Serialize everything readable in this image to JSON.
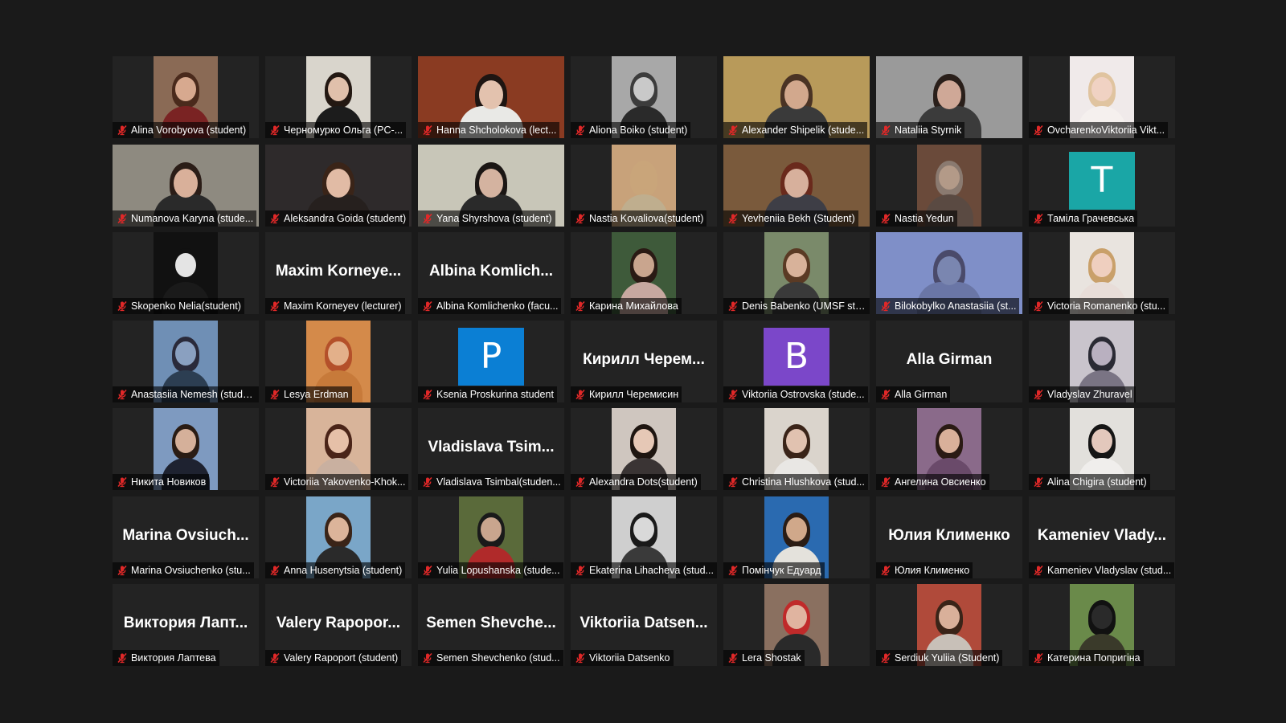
{
  "window": {
    "app": "video-conference",
    "view": "gallery"
  },
  "colors": {
    "background": "#1a1a1a",
    "tile": "#232323",
    "muted_icon": "#e02828",
    "label_text": "#ffffff"
  },
  "participants": [
    {
      "label": "Alina Vorobyova (student)",
      "mode": "video",
      "skin": "#d7a98f",
      "hair": "#4a2a1c",
      "body": "#7a2323",
      "bg": "#8a6a55"
    },
    {
      "label": "Черномурко Ольга (PC-...",
      "mode": "video",
      "skin": "#e0c0ab",
      "hair": "#231812",
      "body": "#1c1c1c",
      "bg": "#d9d5cc"
    },
    {
      "label": "Hanna Shcholokova (lect...",
      "mode": "video",
      "wide": true,
      "skin": "#e3c2ae",
      "hair": "#1e1512",
      "body": "#e9e9e6",
      "bg": "#8a3b22"
    },
    {
      "label": "Aliona Boiko (student)",
      "mode": "video",
      "skin": "#c9c9c9",
      "hair": "#3c3c3c",
      "body": "#2a2a2a",
      "bg": "#a8a8a8"
    },
    {
      "label": "Alexander Shipelik (stude...",
      "mode": "video",
      "wide": true,
      "skin": "#d2a88d",
      "hair": "#4a3324",
      "body": "#3a3a3a",
      "bg": "#b89a5a"
    },
    {
      "label": "Nataliia Styrnik",
      "mode": "video",
      "wide": true,
      "skin": "#cfa897",
      "hair": "#2a1f1a",
      "body": "#3b3b3b",
      "bg": "#9a9a9a"
    },
    {
      "label": "OvcharenkoViktoriia Vikt...",
      "mode": "video",
      "skin": "#f0d2c3",
      "hair": "#e0c4a0",
      "body": "#f5f0ee",
      "bg": "#f0eaea"
    },
    {
      "label": "Numanova Karyna (stude...",
      "mode": "video",
      "wide": true,
      "skin": "#d9b09a",
      "hair": "#2b1d17",
      "body": "#2a2a2a",
      "bg": "#8e8a80"
    },
    {
      "label": "Aleksandra Goida (student)",
      "mode": "video",
      "wide": true,
      "skin": "#e1bba5",
      "hair": "#3a2418",
      "body": "#26201e",
      "bg": "#2e2a2b"
    },
    {
      "label": "Yana Shyrshova (student)",
      "mode": "video",
      "wide": true,
      "skin": "#d4b3a0",
      "hair": "#1b1614",
      "body": "#2a2a2a",
      "bg": "#c8c6b8"
    },
    {
      "label": "Nastia Kovaliova(student)",
      "mode": "video",
      "skin": "#c9a57a",
      "hair": "#c9a57a",
      "body": "#bfae8e",
      "bg": "#c8a27a"
    },
    {
      "label": "Yevheniia Bekh (Student)",
      "mode": "video",
      "wide": true,
      "skin": "#d7b09c",
      "hair": "#6a2a1c",
      "body": "#3e3e46",
      "bg": "#7a5a3c"
    },
    {
      "label": "Nastia Yedun",
      "mode": "video",
      "skin": "#b39a88",
      "hair": "#8a7a70",
      "body": "#5a4a42",
      "bg": "#6a4a3a"
    },
    {
      "label": "Тамiла Грачевська",
      "mode": "letter",
      "letter": "T",
      "avatar_color": "#1aa6a6"
    },
    {
      "label": "Skopenko Nelia(student)",
      "mode": "video",
      "skin": "#e4e4e4",
      "hair": "#111111",
      "body": "#1a1a1a",
      "bg": "#111111"
    },
    {
      "label": "Maxim Korneyev (lecturer)",
      "mode": "name",
      "big": "Maxim  Korneye..."
    },
    {
      "label": "Albina Komlichenko (facu...",
      "mode": "name",
      "big": "Albina  Komlich..."
    },
    {
      "label": "Карина Михайлова",
      "mode": "video",
      "skin": "#c9a58e",
      "hair": "#2a1a14",
      "body": "#c7a8a0",
      "bg": "#3e5a3a"
    },
    {
      "label": "Denis Babenko (UMSF stu...",
      "mode": "video",
      "skin": "#d8b29a",
      "hair": "#5a3a24",
      "body": "#3a3a3a",
      "bg": "#7a8a6a"
    },
    {
      "label": "Bilokobylko Anastasiia (st...",
      "mode": "video",
      "wide": true,
      "skin": "#7a86b0",
      "hair": "#4a4a6a",
      "body": "#6a76a6",
      "bg": "#7f8fc8"
    },
    {
      "label": "Victoria Romanenko (stu...",
      "mode": "video",
      "skin": "#efcfbf",
      "hair": "#c9a06a",
      "body": "#e8ddd8",
      "bg": "#e9e4df"
    },
    {
      "label": "Anastasiia Nemesh (stude...",
      "mode": "video",
      "skin": "#8aa0c0",
      "hair": "#2a2a3a",
      "body": "#2c3e52",
      "bg": "#6f8fb5"
    },
    {
      "label": "Lesya Erdman",
      "mode": "video",
      "skin": "#e3b08a",
      "hair": "#b4502a",
      "body": "#c77a3a",
      "bg": "#d48a4a"
    },
    {
      "label": "Ksenia Proskurina student",
      "mode": "letter",
      "letter": "P",
      "avatar_color": "#0b7fd4"
    },
    {
      "label": "Кирилл Черемисин",
      "mode": "name",
      "big": "Кирилл  Черем..."
    },
    {
      "label": "Viktoriia Ostrovska (stude...",
      "mode": "letter",
      "letter": "B",
      "avatar_color": "#7b47c9"
    },
    {
      "label": "Alla Girman",
      "mode": "name",
      "big": "Alla Girman"
    },
    {
      "label": "Vladyslav Zhuravel",
      "mode": "video",
      "skin": "#b9b0c0",
      "hair": "#2a2a34",
      "body": "#7a7484",
      "bg": "#c9c4cc"
    },
    {
      "label": "Никита Новиков",
      "mode": "video",
      "skin": "#d5b09a",
      "hair": "#2a1c14",
      "body": "#1e2230",
      "bg": "#7e9ac0"
    },
    {
      "label": "Victoriia Yakovenko-Khok...",
      "mode": "video",
      "skin": "#e6c0a8",
      "hair": "#4a2418",
      "body": "#c9b0a0",
      "bg": "#d8b49a"
    },
    {
      "label": "Vladislava Tsimbal(studen...",
      "mode": "name",
      "big": "Vladislava  Tsim..."
    },
    {
      "label": "Alexandra Dots(student)",
      "mode": "video",
      "skin": "#e6c8b6",
      "hair": "#1e1510",
      "body": "#3a3434",
      "bg": "#cfc6bf"
    },
    {
      "label": "Christina Hlushkova (stud...",
      "mode": "video",
      "skin": "#e1c2b0",
      "hair": "#3a2418",
      "body": "#e9e7e4",
      "bg": "#dad4cc"
    },
    {
      "label": "Ангелина Овсиенко",
      "mode": "video",
      "skin": "#d9b09a",
      "hair": "#2a1a14",
      "body": "#6a4a6a",
      "bg": "#8a6a8a"
    },
    {
      "label": "Alina Chigira (student)",
      "mode": "video",
      "skin": "#e3c8bc",
      "hair": "#151515",
      "body": "#f0eeec",
      "bg": "#e2e0dc"
    },
    {
      "label": "Marina Ovsiuchenko (stu...",
      "mode": "name",
      "big": "Marina  Ovsiuch..."
    },
    {
      "label": "Anna Husenytsia (student)",
      "mode": "video",
      "skin": "#dcb49a",
      "hair": "#3a2418",
      "body": "#2a2a2a",
      "bg": "#7aa6c8"
    },
    {
      "label": "Yulia Lopushanska (stude...",
      "mode": "video",
      "skin": "#c9a58e",
      "hair": "#1a1a1a",
      "body": "#b02a2a",
      "bg": "#5a6a3a"
    },
    {
      "label": "Ekaterina Lihacheva (stud...",
      "mode": "video",
      "skin": "#d9d9d9",
      "hair": "#1a1a1a",
      "body": "#3a3a3a",
      "bg": "#cfcfcf"
    },
    {
      "label": "Помінчук Едуард",
      "mode": "video",
      "skin": "#d0a88a",
      "hair": "#2a1c14",
      "body": "#e4e2dc",
      "bg": "#2a6ab0"
    },
    {
      "label": "Юлия Клименко",
      "mode": "name",
      "big": "Юлия Клименко"
    },
    {
      "label": "Kameniev Vladyslav (stud...",
      "mode": "name",
      "big": "Kameniev  Vlady..."
    },
    {
      "label": "Виктория Лаптева",
      "mode": "name",
      "big": "Виктория  Лапт..."
    },
    {
      "label": "Valery Rapoport (student)",
      "mode": "name",
      "big": "Valery  Rapopor..."
    },
    {
      "label": "Semen Shevchenko (stud...",
      "mode": "name",
      "big": "Semen  Shevche..."
    },
    {
      "label": "Viktoriia Datsenko",
      "mode": "name",
      "big": "Viktoriia  Datsen..."
    },
    {
      "label": "Lera Shostak",
      "mode": "video",
      "skin": "#e0b4a0",
      "hair": "#c02a2a",
      "body": "#2a2a2a",
      "bg": "#8a7060"
    },
    {
      "label": "Serdiuk Yuliia (Student)",
      "mode": "video",
      "skin": "#d9b09a",
      "hair": "#3a2418",
      "body": "#c8c0b8",
      "bg": "#b04a3a"
    },
    {
      "label": "Катерина Попригіна",
      "mode": "video",
      "skin": "#2a2a2a",
      "hair": "#111111",
      "body": "#3a3a2a",
      "bg": "#6a8a4a"
    }
  ]
}
